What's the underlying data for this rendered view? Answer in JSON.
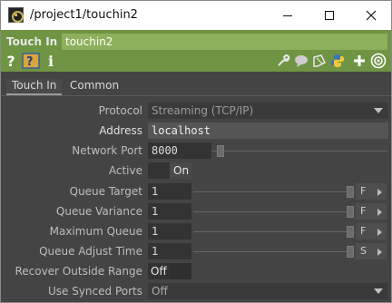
{
  "window": {
    "title": "/project1/touchin2"
  },
  "op": {
    "type_label": "Touch In",
    "name": "touchin2",
    "tools": {
      "help": "?",
      "info": "i"
    }
  },
  "tabs": [
    {
      "label": "Touch In"
    },
    {
      "label": "Common"
    }
  ],
  "params": {
    "protocol": {
      "label": "Protocol",
      "value": "Streaming (TCP/IP)"
    },
    "address": {
      "label": "Address",
      "value": "localhost"
    },
    "network_port": {
      "label": "Network Port",
      "value": "8000"
    },
    "active": {
      "label": "Active",
      "value": "On"
    },
    "queue_target": {
      "label": "Queue Target",
      "value": "1",
      "mode": "F"
    },
    "queue_variance": {
      "label": "Queue Variance",
      "value": "1",
      "mode": "F"
    },
    "maximum_queue": {
      "label": "Maximum Queue",
      "value": "1",
      "mode": "F"
    },
    "queue_adjust_time": {
      "label": "Queue Adjust Time",
      "value": "1",
      "mode": "S"
    },
    "recover_outside_range": {
      "label": "Recover Outside Range",
      "value": "Off"
    },
    "use_synced_ports": {
      "label": "Use Synced Ports",
      "value": "Off"
    }
  },
  "colors": {
    "header_green": "#6f9443",
    "name_field_green": "#8cb05b",
    "panel_bg": "#444444"
  }
}
